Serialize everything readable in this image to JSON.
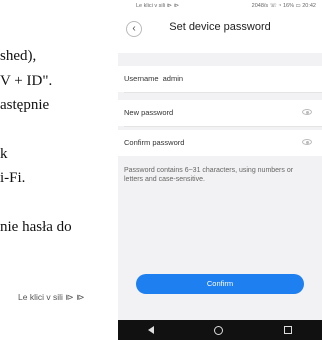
{
  "doc": {
    "lines": [
      "shed),",
      "V + ID\".",
      "astępnie",
      "k",
      "i-Fi.",
      "nie hasła do"
    ],
    "caption": "Le klici v sili ⧐ ⧐"
  },
  "phone": {
    "status_left": "Le klici v sili ⧐ ⧐",
    "status_right": "2048/s ☏ ◔ 16% ▭ 20:42",
    "title": "Set device password",
    "back_glyph": "‹",
    "username_label": "Username",
    "username_value": "admin",
    "new_password_label": "New password",
    "confirm_password_label": "Confirm password",
    "hint": "Password contains 6~31 characters, using numbers or letters and case-sensitive.",
    "confirm_button": "Confirm",
    "nav": {
      "back": "back-icon",
      "home": "home-icon",
      "recent": "recent-apps-icon"
    }
  }
}
